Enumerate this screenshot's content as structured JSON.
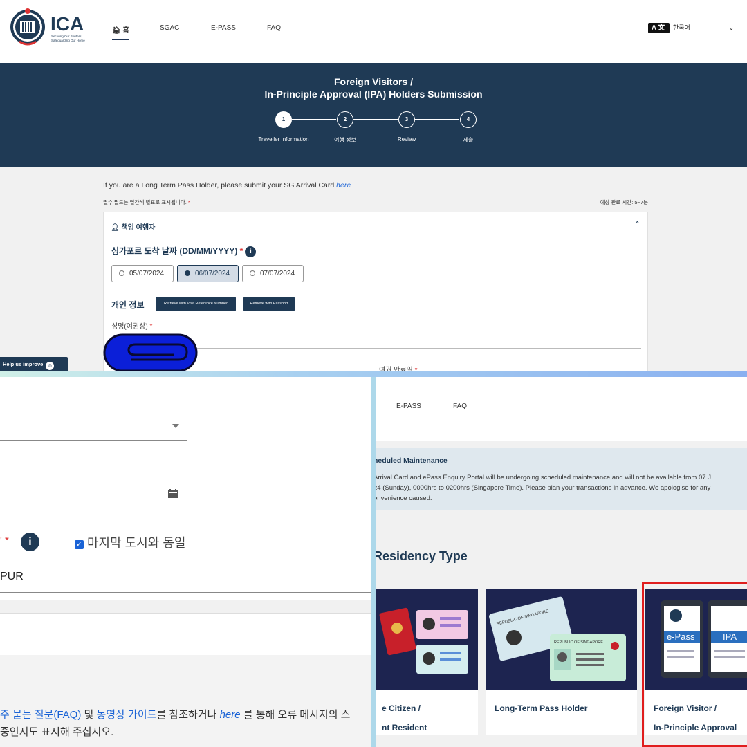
{
  "top": {
    "header": {
      "logo_text": "ICA",
      "logo_tagline_1": "Securing Our Borders,",
      "logo_tagline_2": "Safeguarding Our Home",
      "nav": [
        {
          "label": "홈"
        },
        {
          "label": "SGAC"
        },
        {
          "label": "E-PASS"
        },
        {
          "label": "FAQ"
        }
      ],
      "language_icon_text": "A文",
      "language_value": "한국어"
    },
    "banner": {
      "title_line1": "Foreign Visitors /",
      "title_line2": "In-Principle Approval (IPA) Holders Submission",
      "steps": [
        {
          "num": "1",
          "label": "Traveller Information"
        },
        {
          "num": "2",
          "label": "여행 정보"
        },
        {
          "num": "3",
          "label": "Review"
        },
        {
          "num": "4",
          "label": "제출"
        }
      ]
    },
    "form": {
      "lt_notice": "If you are a Long Term Pass Holder, please submit your SG Arrival Card",
      "lt_link": "here",
      "required_note": "필수 필드는 빨간색 별표로 표시됩니다.",
      "required_star": "*",
      "est_time": "예상 완료 시간: 5~7분",
      "section_title": "책임 여행자",
      "arrival_label": "싱가포르 도착 날짜 (DD/MM/YYYY)",
      "dates": [
        "05/07/2024",
        "06/07/2024",
        "07/07/2024"
      ],
      "selected_date": "06/07/2024",
      "personal_info_label": "개인 정보",
      "retrieve_visa": "Retrieve with Visa Reference Number",
      "retrieve_passport": "Retrieve with Passport",
      "name_label": "성명(여권상)",
      "passport_expiry_label": "여권 만료일",
      "help_label": "Help us improve"
    }
  },
  "bottom_left": {
    "same_city_label": "마지막 도시와 동일",
    "city_value_fragment": "PUR",
    "faq_text_1": "주 묻는 질문(FAQ)",
    "faq_text_2": " 및 ",
    "faq_text_3": "동영상 가이드",
    "faq_text_4": "를 참조하거나 ",
    "faq_text_5": "here",
    "faq_text_6": " 를 통해 오류 메시지의 스",
    "faq_line2": "중인지도 표시해 주십시오."
  },
  "bottom_right": {
    "nav": [
      {
        "label": "E-PASS"
      },
      {
        "label": "FAQ"
      }
    ],
    "maintenance_title": "heduled Maintenance",
    "maintenance_line1": "Arrival Card and ePass Enquiry Portal will be undergoing scheduled maintenance and will not be available from 07 J",
    "maintenance_line2": "24 (Sunday), 0000hrs to 0200hrs (Singapore Time). Please plan your transactions in advance. We apologise for any",
    "maintenance_line3": "onvenience caused.",
    "residency_title": "Residency Type",
    "cards": [
      {
        "line1": "e Citizen /",
        "line2": "nt Resident"
      },
      {
        "line1": "Long-Term Pass Holder",
        "line2": ""
      },
      {
        "line1": "Foreign Visitor /",
        "line2": "In-Principle Approval"
      }
    ],
    "epass_label": "e-Pass",
    "ipa_label": "IPA",
    "rep_sg_label": "REPUBLIC OF SINGAPORE"
  },
  "colors": {
    "navy": "#1f3a55",
    "link": "#1a63d6",
    "required": "#d33",
    "highlight": "#e01e1e"
  }
}
